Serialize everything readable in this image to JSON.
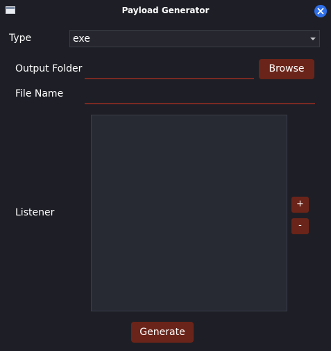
{
  "window": {
    "title": "Payload Generator"
  },
  "type": {
    "label": "Type",
    "selected": "exe"
  },
  "output_folder": {
    "label": "Output Folder",
    "value": "",
    "browse_label": "Browse"
  },
  "file_name": {
    "label": "File Name",
    "value": ""
  },
  "listener": {
    "label": "Listener",
    "items": [],
    "add_label": "+",
    "remove_label": "-"
  },
  "actions": {
    "generate_label": "Generate"
  },
  "icons": {
    "app": "window-icon",
    "close": "close-icon",
    "dropdown": "chevron-down-icon"
  },
  "colors": {
    "background": "#1e1f26",
    "accent": "#6b2419",
    "underline": "#7a2a22",
    "close_button": "#2f6fe8"
  }
}
